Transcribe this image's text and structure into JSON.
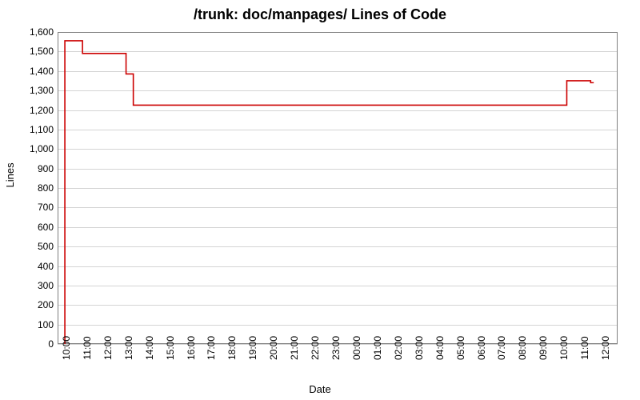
{
  "chart_data": {
    "type": "line",
    "title": "/trunk: doc/manpages/ Lines of Code",
    "xlabel": "Date",
    "ylabel": "Lines",
    "ylim": [
      0,
      1600
    ],
    "x_range": [
      0,
      27
    ],
    "x_ticks": [
      {
        "pos": 0,
        "label": "10:00"
      },
      {
        "pos": 1,
        "label": "11:00"
      },
      {
        "pos": 2,
        "label": "12:00"
      },
      {
        "pos": 3,
        "label": "13:00"
      },
      {
        "pos": 4,
        "label": "14:00"
      },
      {
        "pos": 5,
        "label": "15:00"
      },
      {
        "pos": 6,
        "label": "16:00"
      },
      {
        "pos": 7,
        "label": "17:00"
      },
      {
        "pos": 8,
        "label": "18:00"
      },
      {
        "pos": 9,
        "label": "19:00"
      },
      {
        "pos": 10,
        "label": "20:00"
      },
      {
        "pos": 11,
        "label": "21:00"
      },
      {
        "pos": 12,
        "label": "22:00"
      },
      {
        "pos": 13,
        "label": "23:00"
      },
      {
        "pos": 14,
        "label": "00:00"
      },
      {
        "pos": 15,
        "label": "01:00"
      },
      {
        "pos": 16,
        "label": "02:00"
      },
      {
        "pos": 17,
        "label": "03:00"
      },
      {
        "pos": 18,
        "label": "04:00"
      },
      {
        "pos": 19,
        "label": "05:00"
      },
      {
        "pos": 20,
        "label": "06:00"
      },
      {
        "pos": 21,
        "label": "07:00"
      },
      {
        "pos": 22,
        "label": "08:00"
      },
      {
        "pos": 23,
        "label": "09:00"
      },
      {
        "pos": 24,
        "label": "10:00"
      },
      {
        "pos": 25,
        "label": "11:00"
      },
      {
        "pos": 26,
        "label": "12:00"
      }
    ],
    "y_ticks": [
      0,
      100,
      200,
      300,
      400,
      500,
      600,
      700,
      800,
      900,
      1000,
      1100,
      1200,
      1300,
      1400,
      1500,
      1600
    ],
    "series": [
      {
        "name": "Lines",
        "color": "#cc0000",
        "points": [
          {
            "x": 0.35,
            "y": 0
          },
          {
            "x": 0.35,
            "y": 1555
          },
          {
            "x": 1.2,
            "y": 1555
          },
          {
            "x": 1.2,
            "y": 1490
          },
          {
            "x": 3.3,
            "y": 1490
          },
          {
            "x": 3.3,
            "y": 1385
          },
          {
            "x": 3.65,
            "y": 1385
          },
          {
            "x": 3.65,
            "y": 1225
          },
          {
            "x": 24.55,
            "y": 1225
          },
          {
            "x": 24.55,
            "y": 1350
          },
          {
            "x": 25.7,
            "y": 1350
          },
          {
            "x": 25.7,
            "y": 1340
          },
          {
            "x": 25.85,
            "y": 1340
          }
        ]
      }
    ]
  }
}
